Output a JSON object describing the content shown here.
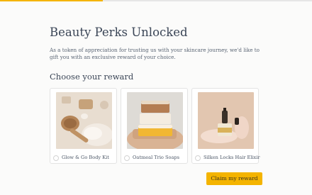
{
  "progress": {
    "fraction": 0.33,
    "color": "#f4b400"
  },
  "header": {
    "title": "Beauty Perks Unlocked",
    "description": "As a token of appreciation for trusting us with your skincare journey, we'd like to gift you with an exclusive reward of your choice."
  },
  "rewards": {
    "heading": "Choose your reward",
    "items": [
      {
        "label": "Glow & Go Body Kit",
        "image": "brush-and-soap-photo",
        "selected": false
      },
      {
        "label": "Oatmeal Trio Soaps",
        "image": "stacked-soap-bars-photo",
        "selected": false
      },
      {
        "label": "Silken Locks Hair Elixir",
        "image": "serum-bottle-photo",
        "selected": false
      }
    ]
  },
  "actions": {
    "claim_label": "Claim my reward"
  },
  "colors": {
    "accent": "#f4b400",
    "text": "#3a4556",
    "background": "#fbfbfa"
  }
}
